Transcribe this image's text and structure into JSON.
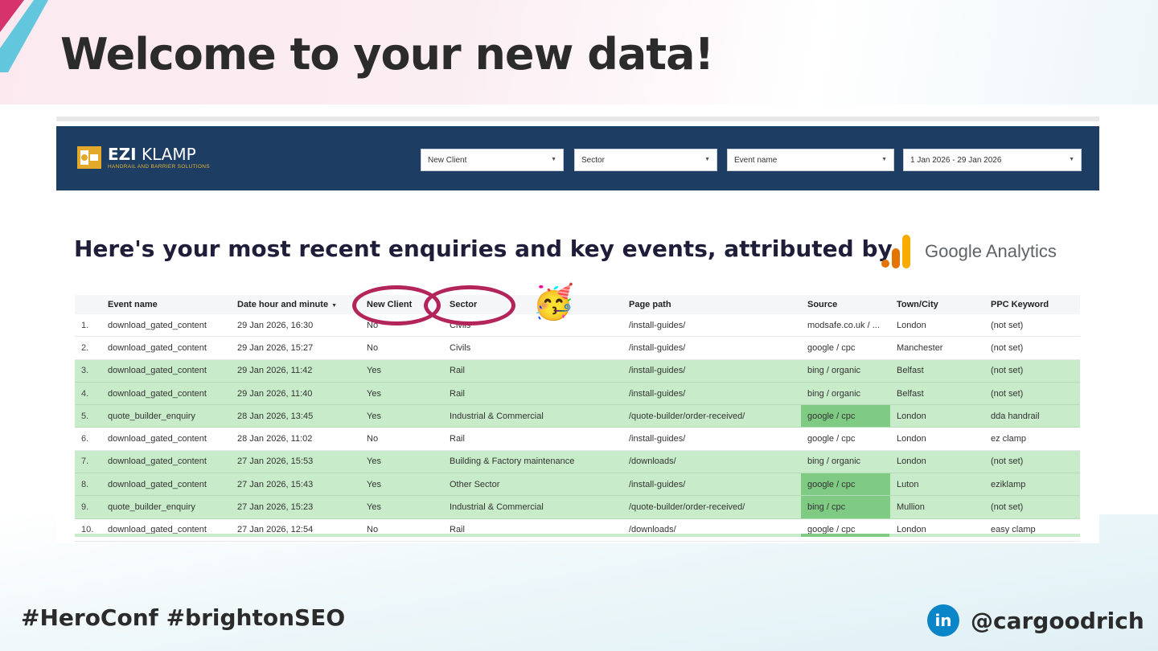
{
  "slide": {
    "title": "Welcome to your new data!",
    "hashtags": "#HeroConf #brightonSEO",
    "social_handle": "@cargoodrich",
    "social_icon": "linkedin-icon",
    "social_icon_text": "in"
  },
  "dashboard": {
    "logo": {
      "name_bold": "EZI",
      "name_rest": "KLAMP",
      "tagline": "HANDRAIL AND BARRIER SOLUTIONS"
    },
    "filters": [
      {
        "label": "New Client"
      },
      {
        "label": "Sector"
      },
      {
        "label": "Event name"
      },
      {
        "label": "1 Jan 2026 - 29 Jan 2026"
      }
    ],
    "heading": "Here's your most recent enquiries and key events, attributed by",
    "ga_logo_text": "Google Analytics",
    "emoji": "🥳",
    "table": {
      "columns": [
        "",
        "Event name",
        "Date hour and minute",
        "New Client",
        "Sector",
        "Page path",
        "Source",
        "Town/City",
        "PPC Keyword"
      ],
      "sort_indicator": "▼",
      "rows": [
        {
          "num": "1.",
          "event": "download_gated_content",
          "date": "29 Jan 2026, 16:30",
          "new_client": "No",
          "sector": "Civils",
          "path": "/install-guides/",
          "source": "modsafe.co.uk / ...",
          "town": "London",
          "keyword": "(not set)"
        },
        {
          "num": "2.",
          "event": "download_gated_content",
          "date": "29 Jan 2026, 15:27",
          "new_client": "No",
          "sector": "Civils",
          "path": "/install-guides/",
          "source": "google / cpc",
          "town": "Manchester",
          "keyword": "(not set)"
        },
        {
          "num": "3.",
          "event": "download_gated_content",
          "date": "29 Jan 2026, 11:42",
          "new_client": "Yes",
          "sector": "Rail",
          "path": "/install-guides/",
          "source": "bing / organic",
          "town": "Belfast",
          "keyword": "(not set)"
        },
        {
          "num": "4.",
          "event": "download_gated_content",
          "date": "29 Jan 2026, 11:40",
          "new_client": "Yes",
          "sector": "Rail",
          "path": "/install-guides/",
          "source": "bing / organic",
          "town": "Belfast",
          "keyword": "(not set)"
        },
        {
          "num": "5.",
          "event": "quote_builder_enquiry",
          "date": "28 Jan 2026, 13:45",
          "new_client": "Yes",
          "sector": "Industrial & Commercial",
          "path": "/quote-builder/order-received/",
          "source": "google / cpc",
          "town": "London",
          "keyword": "dda handrail"
        },
        {
          "num": "6.",
          "event": "download_gated_content",
          "date": "28 Jan 2026, 11:02",
          "new_client": "No",
          "sector": "Rail",
          "path": "/install-guides/",
          "source": "google / cpc",
          "town": "London",
          "keyword": "ez clamp"
        },
        {
          "num": "7.",
          "event": "download_gated_content",
          "date": "27 Jan 2026, 15:53",
          "new_client": "Yes",
          "sector": "Building & Factory maintenance",
          "path": "/downloads/",
          "source": "bing / organic",
          "town": "London",
          "keyword": "(not set)"
        },
        {
          "num": "8.",
          "event": "download_gated_content",
          "date": "27 Jan 2026, 15:43",
          "new_client": "Yes",
          "sector": "Other Sector",
          "path": "/install-guides/",
          "source": "google / cpc",
          "town": "Luton",
          "keyword": "eziklamp"
        },
        {
          "num": "9.",
          "event": "quote_builder_enquiry",
          "date": "27 Jan 2026, 15:23",
          "new_client": "Yes",
          "sector": "Industrial & Commercial",
          "path": "/quote-builder/order-received/",
          "source": "bing / cpc",
          "town": "Mullion",
          "keyword": "(not set)"
        },
        {
          "num": "10.",
          "event": "download_gated_content",
          "date": "27 Jan 2026, 12:54",
          "new_client": "No",
          "sector": "Rail",
          "path": "/downloads/",
          "source": "google / cpc",
          "town": "London",
          "keyword": "easy clamp"
        }
      ]
    }
  },
  "colors": {
    "header_bg": "#1e3d63",
    "new_client_row": "#c8ebc9",
    "paid_source_highlight": "#7fcb84",
    "annotation_circle": "#b3245a",
    "linkedin": "#0a85c7"
  }
}
